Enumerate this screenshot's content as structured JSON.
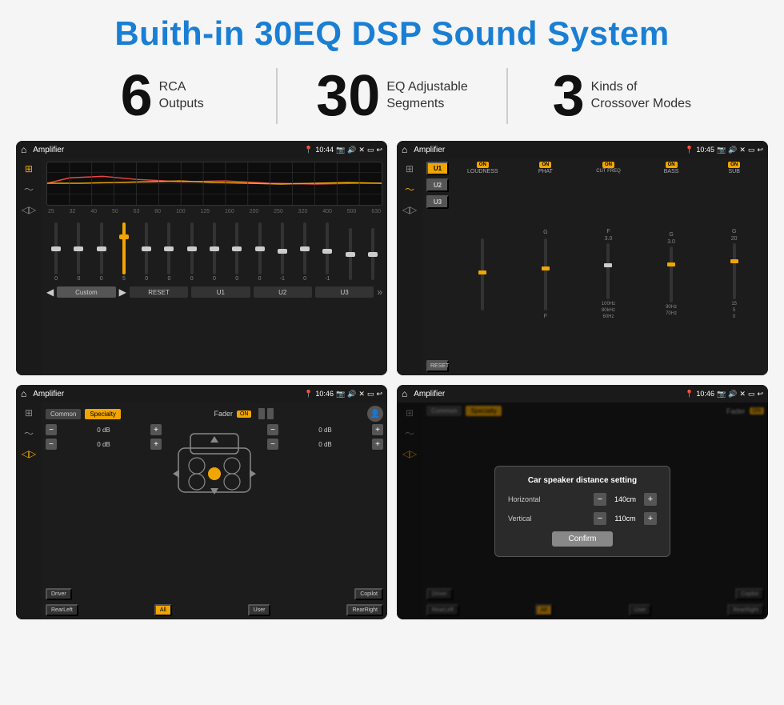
{
  "header": {
    "title": "Buith-in 30EQ DSP Sound System"
  },
  "stats": [
    {
      "number": "6",
      "label": "RCA\nOutputs"
    },
    {
      "number": "30",
      "label": "EQ Adjustable\nSegments"
    },
    {
      "number": "3",
      "label": "Kinds of\nCrossover Modes"
    }
  ],
  "screens": [
    {
      "id": "eq-screen",
      "title": "Amplifier",
      "time": "10:44",
      "type": "eq"
    },
    {
      "id": "crossover-screen",
      "title": "Amplifier",
      "time": "10:45",
      "type": "crossover"
    },
    {
      "id": "fader-screen",
      "title": "Amplifier",
      "time": "10:46",
      "type": "fader"
    },
    {
      "id": "distance-screen",
      "title": "Amplifier",
      "time": "10:46",
      "type": "distance"
    }
  ],
  "eq": {
    "freqs": [
      "25",
      "32",
      "40",
      "50",
      "63",
      "80",
      "100",
      "125",
      "160",
      "200",
      "250",
      "320",
      "400",
      "500",
      "630"
    ],
    "values": [
      "0",
      "0",
      "0",
      "5",
      "0",
      "0",
      "0",
      "0",
      "0",
      "0",
      "-1",
      "0",
      "-1",
      "",
      ""
    ],
    "modes": [
      "Custom",
      "RESET",
      "U1",
      "U2",
      "U3"
    ]
  },
  "crossover": {
    "channels": [
      "LOUDNESS",
      "PHAT",
      "CUT FREQ",
      "BASS",
      "SUB"
    ],
    "u_buttons": [
      "U1",
      "U2",
      "U3"
    ]
  },
  "fader": {
    "tabs": [
      "Common",
      "Specialty"
    ],
    "label": "Fader",
    "on": "ON",
    "bottom_labels": [
      "Driver",
      "Copilot",
      "RearLeft",
      "All",
      "User",
      "RearRight"
    ]
  },
  "distance_dialog": {
    "title": "Car speaker distance setting",
    "horizontal_label": "Horizontal",
    "horizontal_value": "140cm",
    "vertical_label": "Vertical",
    "vertical_value": "110cm",
    "confirm_label": "Confirm"
  }
}
